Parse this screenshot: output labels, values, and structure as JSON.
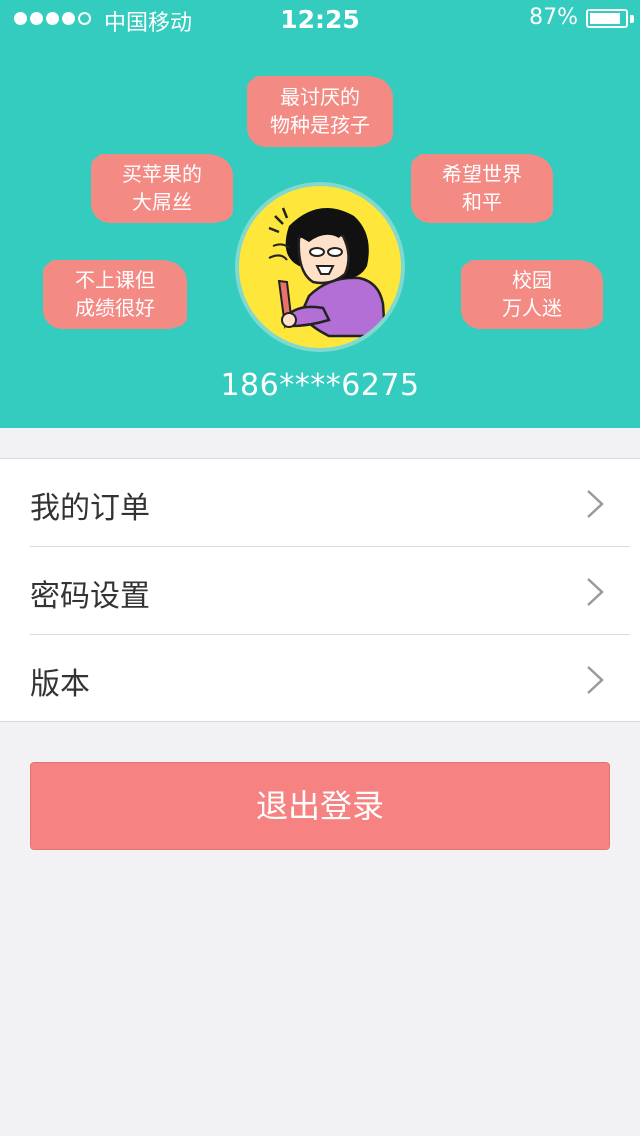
{
  "status_bar": {
    "carrier": "中国移动",
    "time": "12:25",
    "battery_percent": "87%",
    "battery_level": 0.87,
    "signal_bars_filled": 4,
    "signal_bars_total": 5
  },
  "profile": {
    "tags": [
      {
        "line1": "最讨厌的",
        "line2": "物种是孩子"
      },
      {
        "line1": "买苹果的",
        "line2": "大屌丝"
      },
      {
        "line1": "希望世界",
        "line2": "和平"
      },
      {
        "line1": "不上课但",
        "line2": "成绩很好"
      },
      {
        "line1": "校园",
        "line2": "万人迷"
      }
    ],
    "phone": "186****6275"
  },
  "menu": {
    "items": [
      {
        "label": "我的订单",
        "icon": "chevron-right-icon"
      },
      {
        "label": "密码设置",
        "icon": "chevron-right-icon"
      },
      {
        "label": "版本",
        "icon": "chevron-right-icon"
      }
    ]
  },
  "logout": {
    "label": "退出登录"
  },
  "colors": {
    "header_bg": "#33ccbf",
    "tag_bg": "#f48a84",
    "logout_bg": "#f78282",
    "page_bg": "#f2f2f4"
  }
}
